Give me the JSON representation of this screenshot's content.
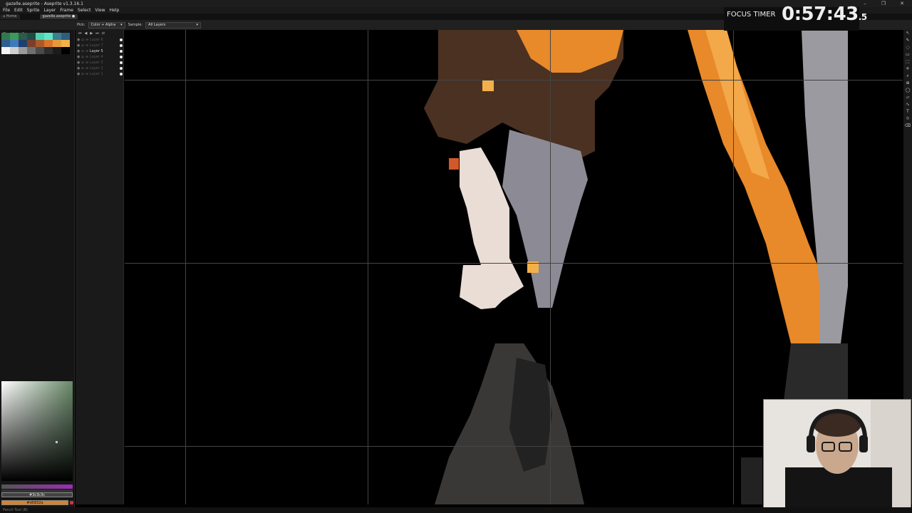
{
  "window": {
    "title": "gazelle.aseprite - Aseprite v1.3.16.1",
    "controls": [
      "–",
      "❐",
      "✕"
    ]
  },
  "menu": {
    "items": [
      "File",
      "Edit",
      "Sprite",
      "Layer",
      "Frame",
      "Select",
      "View",
      "Help"
    ]
  },
  "tabs": {
    "home": "⌂ Home",
    "file": "gazelle.aseprite ●"
  },
  "toolbar": {
    "pick_label": "Pick:",
    "pick_value": "Color + Alpha",
    "sample_label": "Sample:",
    "sample_value": "All Layers"
  },
  "palette": {
    "colors": [
      "#2e7a4e",
      "#3a9a5b",
      "#2c5b4a",
      "#1f4a46",
      "#4fd1b0",
      "#5ee6c6",
      "#3b7f93",
      "#2e5f7a",
      "#2f5e8f",
      "#3f7bb8",
      "#1f3f6f",
      "#7a3f2a",
      "#a85a2f",
      "#d8752b",
      "#e89a3a",
      "#f1b24a",
      "#f3f3f3",
      "#cfcfcf",
      "#9b9b9b",
      "#6f6f6f",
      "#4a4a4a",
      "#2e2e2e",
      "#1c1c1c",
      "#000000"
    ],
    "toolbar_buttons": [
      "≡",
      "◂",
      "▸",
      "▾"
    ]
  },
  "timeline": {
    "controls": [
      "⏮",
      "◀",
      "▶",
      "⏭",
      "⇄"
    ],
    "layers": [
      {
        "name": "Layer 6",
        "active": false
      },
      {
        "name": "Layer 7",
        "active": false
      },
      {
        "name": "Layer 5",
        "active": true
      },
      {
        "name": "Layer 4",
        "active": false
      },
      {
        "name": "Layer 3",
        "active": false
      },
      {
        "name": "Layer 2",
        "active": false
      },
      {
        "name": "Layer 1",
        "active": false
      }
    ]
  },
  "colors": {
    "bg_label": "#3c3c3c",
    "fg_label": "#d5832a"
  },
  "statusbar": {
    "text": "Pencil Tool (B)"
  },
  "focus_timer": {
    "label": "FOCUS TIMER",
    "value": "0:57:43",
    "fraction": ".5"
  },
  "right_tools": [
    "↖",
    "✎",
    "◌",
    "▭",
    "⬚",
    "✛",
    "⌕",
    "⊕",
    "◯",
    "▱",
    "∿",
    "T",
    "⟐",
    "⌫"
  ],
  "accent_colors": {
    "orange": "#e8892a",
    "light_orange": "#f3a84a",
    "brown": "#4a3122",
    "gray_light": "#9a9aa0",
    "bone": "#e9ddd6"
  }
}
